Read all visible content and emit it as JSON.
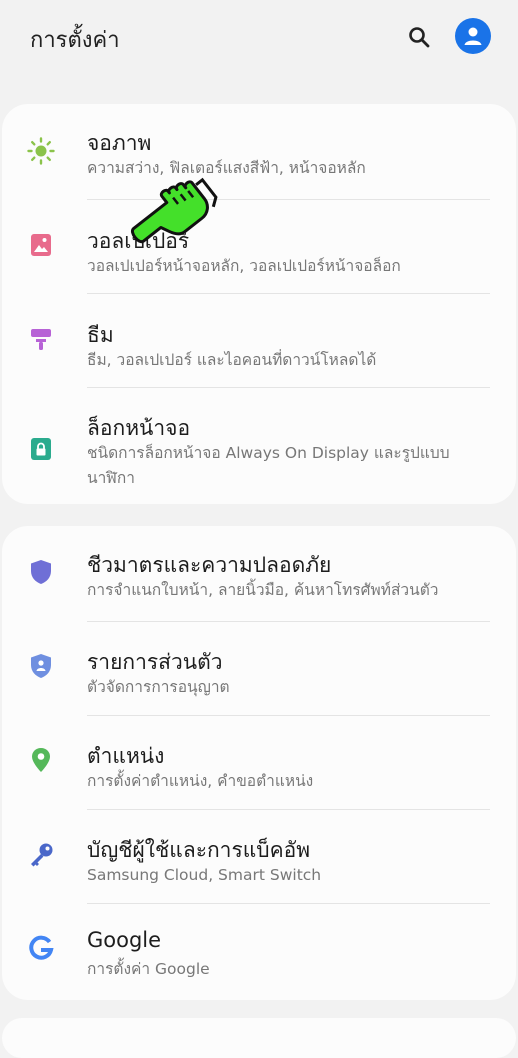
{
  "header": {
    "title": "การตั้งค่า",
    "search_icon": "search-icon",
    "profile_icon": "account-circle-icon"
  },
  "cards": [
    {
      "items": [
        {
          "title": "จอภาพ",
          "subtitle": "ความสว่าง, ฟิลเตอร์แสงสีฟ้า, หน้าจอหลัก",
          "icon": "sun-icon",
          "color": "#8bc34a"
        },
        {
          "title": "วอลเปเปอร์",
          "subtitle": "วอลเปเปอร์หน้าจอหลัก, วอลเปเปอร์หน้าจอล็อก",
          "icon": "picture-icon",
          "color": "#e86b8c"
        },
        {
          "title": "ธีม",
          "subtitle": "ธีม, วอลเปเปอร์ และไอคอนที่ดาวน์โหลดได้",
          "icon": "paint-roller-icon",
          "color": "#b762d6"
        },
        {
          "title": "ล็อกหน้าจอ",
          "subtitle": "ชนิดการล็อกหน้าจอ Always On Display และรูปแบบนาฬิกา",
          "icon": "lock-icon",
          "color": "#2bab8e"
        }
      ]
    },
    {
      "items": [
        {
          "title": "ชีวมาตรและความปลอดภัย",
          "subtitle": "การจำแนกใบหน้า, ลายนิ้วมือ, ค้นหาโทรศัพท์ส่วนตัว",
          "icon": "shield-icon",
          "color": "#6f6fd6"
        },
        {
          "title": "รายการส่วนตัว",
          "subtitle": "ตัวจัดการการอนุญาต",
          "icon": "privacy-shield-icon",
          "color": "#6f8fe0"
        },
        {
          "title": "ตำแหน่ง",
          "subtitle": "การตั้งค่าตำแหน่ง, คำขอตำแหน่ง",
          "icon": "location-pin-icon",
          "color": "#55b85a"
        },
        {
          "title": "บัญชีผู้ใช้และการแบ็คอัพ",
          "subtitle": "Samsung Cloud, Smart Switch",
          "icon": "key-icon",
          "color": "#4a67c9"
        },
        {
          "title": "Google",
          "subtitle": "การตั้งค่า Google",
          "icon": "google-icon",
          "color": "#4285f4"
        }
      ]
    }
  ],
  "overlay": {
    "icon": "pointing-hand-cursor-icon",
    "color": "#44e02a"
  }
}
